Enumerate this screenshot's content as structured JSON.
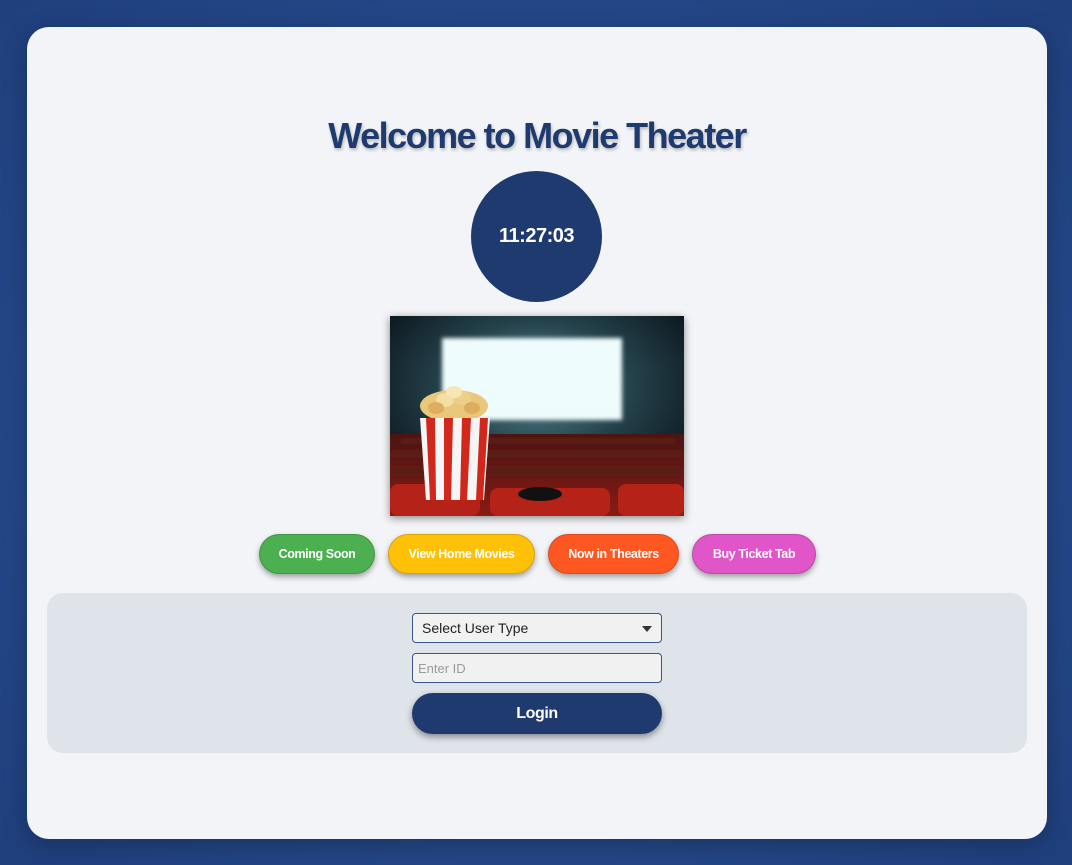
{
  "header": {
    "title": "Welcome to Movie Theater"
  },
  "clock": {
    "time": "11:27:03"
  },
  "hero": {
    "image": "popcorn-cinema-image"
  },
  "nav_buttons": [
    {
      "label": "Coming Soon",
      "color": "#4caf50"
    },
    {
      "label": "View Home Movies",
      "color": "#ffc107"
    },
    {
      "label": "Now in Theaters",
      "color": "#ff5722"
    },
    {
      "label": "Buy Ticket Tab",
      "color": "#e055c8"
    }
  ],
  "login": {
    "user_type_selected": "Select User Type",
    "id_placeholder": "Enter ID",
    "id_value": "",
    "button_label": "Login"
  },
  "colors": {
    "primary": "#1f3a6e",
    "background": "#24498a",
    "card": "#f2f4f7",
    "panel": "#dfe3ea"
  }
}
